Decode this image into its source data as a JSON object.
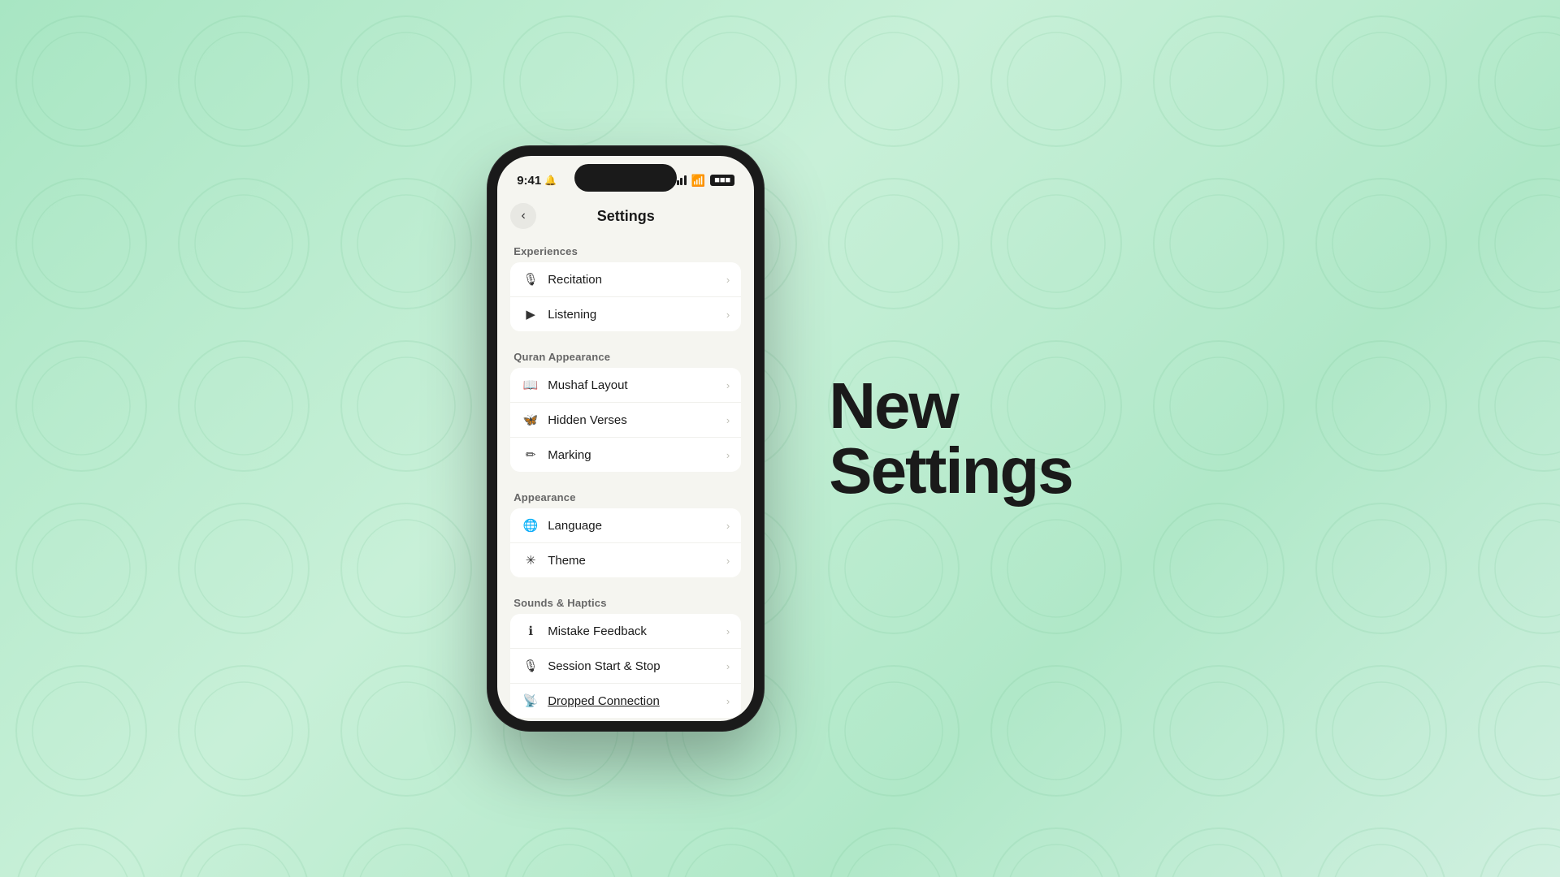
{
  "background": {
    "color_start": "#a8e6c3",
    "color_end": "#d0f0e0"
  },
  "phone": {
    "status_bar": {
      "time": "9:41",
      "bell_icon": "🔔"
    },
    "nav": {
      "back_label": "‹",
      "title": "Settings"
    },
    "sections": [
      {
        "id": "experiences",
        "title": "Experiences",
        "items": [
          {
            "id": "recitation",
            "icon": "🎙",
            "label": "Recitation"
          },
          {
            "id": "listening",
            "icon": "▶",
            "label": "Listening"
          }
        ]
      },
      {
        "id": "quran-appearance",
        "title": "Quran Appearance",
        "items": [
          {
            "id": "mushaf-layout",
            "icon": "📖",
            "label": "Mushaf Layout"
          },
          {
            "id": "hidden-verses",
            "icon": "🦋",
            "label": "Hidden Verses"
          },
          {
            "id": "marking",
            "icon": "✏",
            "label": "Marking"
          }
        ]
      },
      {
        "id": "appearance",
        "title": "Appearance",
        "items": [
          {
            "id": "language",
            "icon": "🌐",
            "label": "Language"
          },
          {
            "id": "theme",
            "icon": "✳",
            "label": "Theme"
          }
        ]
      },
      {
        "id": "sounds-haptics",
        "title": "Sounds & Haptics",
        "items": [
          {
            "id": "mistake-feedback",
            "icon": "ℹ",
            "label": "Mistake Feedback"
          },
          {
            "id": "session-start-stop",
            "icon": "🎙",
            "label": "Session Start & Stop"
          },
          {
            "id": "dropped-connection",
            "icon": "📡",
            "label": "Dropped Connection",
            "underline": true
          }
        ]
      }
    ]
  },
  "headline": {
    "line1": "New",
    "line2": "Settings"
  }
}
